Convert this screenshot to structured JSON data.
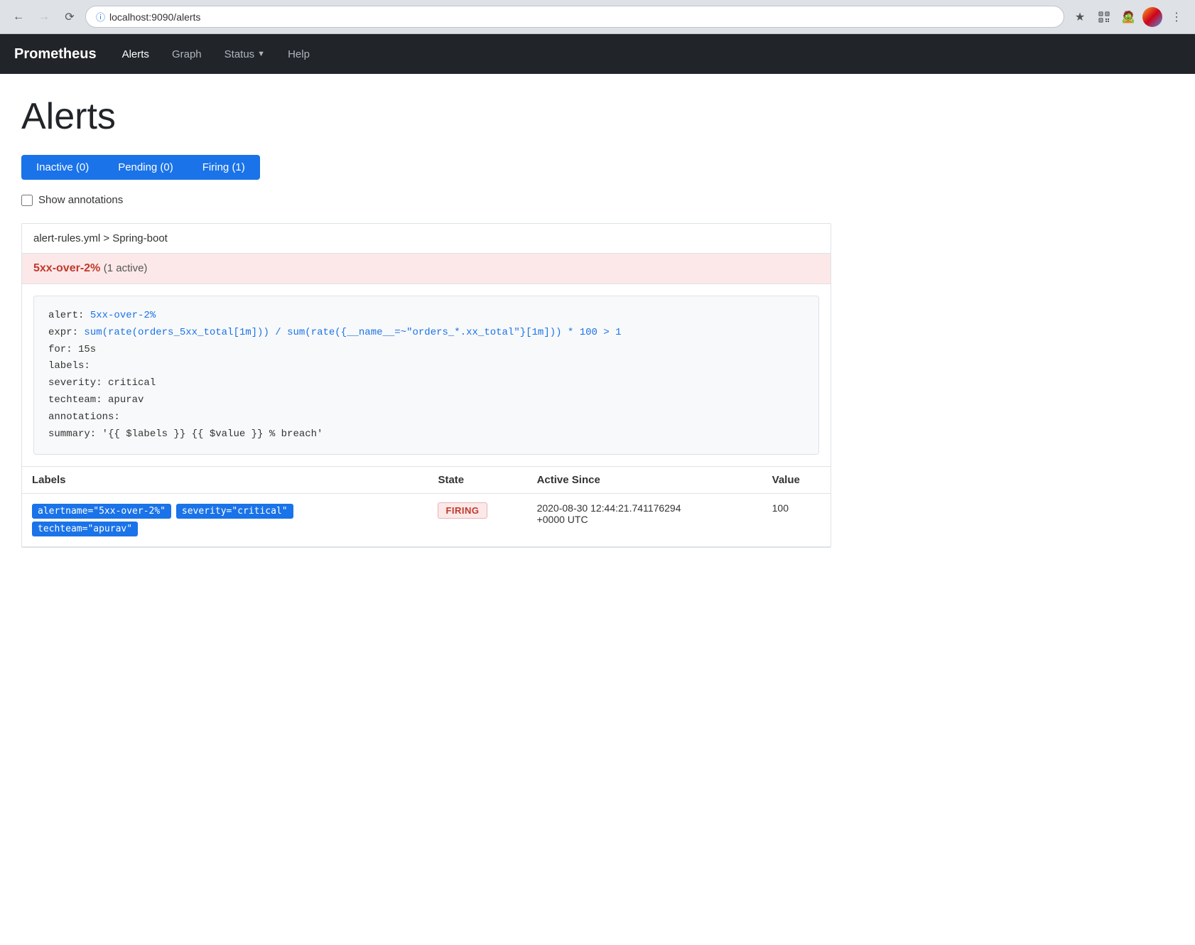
{
  "browser": {
    "url": "localhost:9090/alerts",
    "back_title": "back",
    "forward_title": "forward",
    "reload_title": "reload"
  },
  "nav": {
    "brand": "Prometheus",
    "links": [
      {
        "label": "Alerts",
        "href": "#alerts",
        "active": true
      },
      {
        "label": "Graph",
        "href": "#graph",
        "active": false
      },
      {
        "label": "Status",
        "href": "#status",
        "active": false,
        "dropdown": true
      },
      {
        "label": "Help",
        "href": "#help",
        "active": false
      }
    ]
  },
  "page": {
    "title": "Alerts"
  },
  "filters": [
    {
      "label": "Inactive (0)",
      "id": "inactive"
    },
    {
      "label": "Pending (0)",
      "id": "pending"
    },
    {
      "label": "Firing (1)",
      "id": "firing"
    }
  ],
  "annotations": {
    "label": "Show annotations",
    "checked": false
  },
  "alert_group": {
    "breadcrumb": "alert-rules.yml > Spring-boot",
    "rule": {
      "name": "5xx-over-2%",
      "active_count": "(1 active)",
      "code": {
        "line1_prefix": "alert: ",
        "line1_value": "5xx-over-2%",
        "line2_prefix": "expr: ",
        "line2_value": "sum(rate(orders_5xx_total[1m])) / sum(rate({__name__=~\"orders_*.xx_total\"}[1m])) * 100 > 1",
        "line3": "for: 15s",
        "line4": "labels:",
        "line5": "  severity: critical",
        "line6": "  techteam: apurav",
        "line7": "annotations:",
        "line8": "  summary: '{{ $labels }}  {{ $value }} % breach'"
      }
    },
    "table": {
      "headers": [
        "Labels",
        "State",
        "Active Since",
        "Value"
      ],
      "rows": [
        {
          "labels": [
            "alertname=\"5xx-over-2%\"",
            "severity=\"critical\"",
            "techteam=\"apurav\""
          ],
          "state": "FIRING",
          "active_since": "2020-08-30 12:44:21.741176294\n+0000 UTC",
          "active_since_line1": "2020-08-30 12:44:21.741176294",
          "active_since_line2": "+0000 UTC",
          "value": "100"
        }
      ]
    }
  }
}
